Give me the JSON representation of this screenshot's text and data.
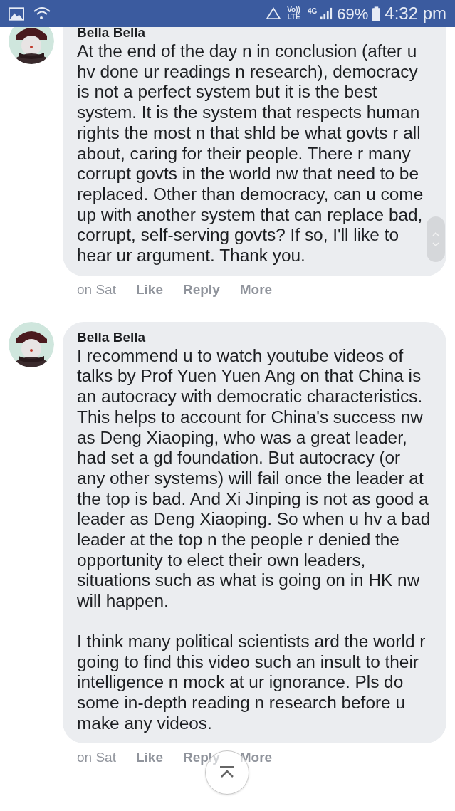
{
  "status_bar": {
    "volte_top": "Vo))",
    "volte_bottom": "LTE",
    "network": "4G",
    "battery_percent": "69%",
    "time": "4:32 pm"
  },
  "comments": [
    {
      "author": "Bella Bella",
      "paragraphs": [
        "At the end of the day n in conclusion (after u hv done ur readings n research), democracy is not a perfect system but it is the best system. It is the system that respects human rights the most n that shld be what govts r all about, caring for their people. There r many corrupt govts in the world nw that need to be replaced. Other than democracy, can u come up with another system that can replace bad, corrupt, self-serving govts? If so, I'll like to hear ur argument. Thank you."
      ],
      "time": "on Sat",
      "actions": [
        "Like",
        "Reply",
        "More"
      ]
    },
    {
      "author": "Bella Bella",
      "paragraphs": [
        "I recommend u to watch youtube videos of talks by Prof Yuen Yuen Ang on that China is an autocracy with democratic characteristics. This helps to account for China's success nw as Deng Xiaoping, who was a great leader, had set a gd foundation. But autocracy (or any other systems) will fail once the leader at the top is bad. And Xi Jinping is not as good a leader as Deng Xiaoping. So when u hv a bad leader at the top n the people r denied the opportunity to elect their own leaders, situations such as what is going on in HK nw will happen.",
        "I think many political scientists ard the world r going to find this video such an insult to their intelligence n mock at ur ignorance. Pls do some in-depth reading n research before u make any videos."
      ],
      "time": "on Sat",
      "actions": [
        "Like",
        "Reply",
        "More"
      ]
    }
  ]
}
